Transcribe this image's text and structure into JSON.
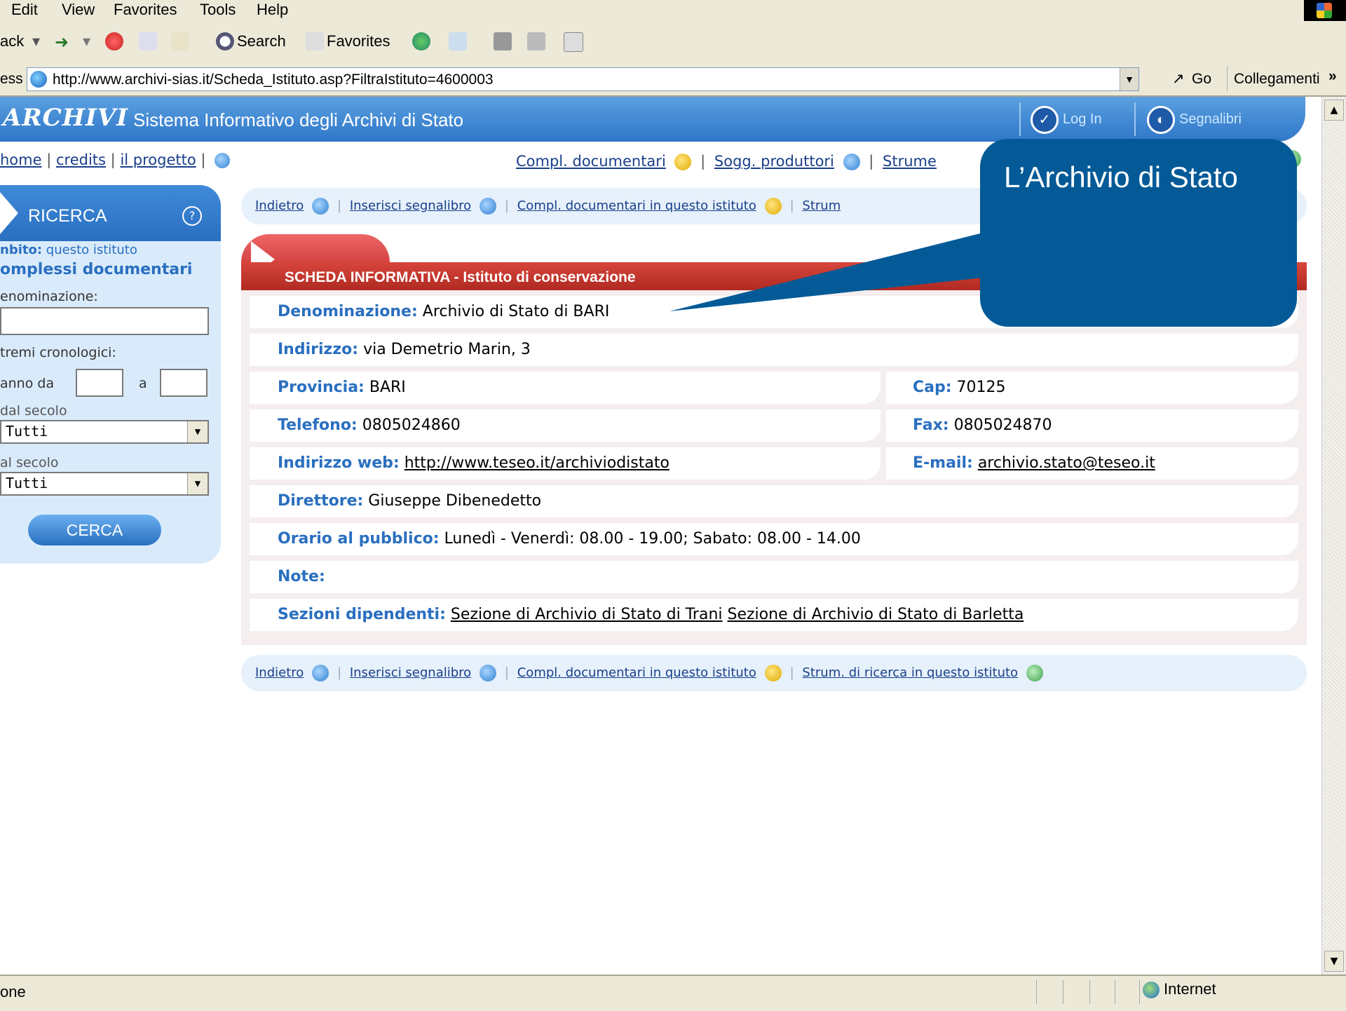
{
  "menu": [
    "Edit",
    "View",
    "Favorites",
    "Tools",
    "Help"
  ],
  "toolbar": {
    "back": "ack",
    "search": "Search",
    "favorites": "Favorites"
  },
  "address": {
    "label": "ess",
    "url": "http://www.archivi-sias.it/Scheda_Istituto.asp?FiltraIstituto=4600003",
    "go": "Go",
    "links": "Collegamenti",
    "more": "»"
  },
  "header": {
    "brand": "ARCHIVI",
    "subtitle": "Sistema Informativo degli Archivi di Stato",
    "login": "Log In",
    "bookmarks": "Segnalibri"
  },
  "toplinks": {
    "home": "home",
    "credits": "credits",
    "project": "il progetto",
    "compl": "Compl. documentari",
    "sogg": "Sogg. produttori",
    "strum": "Strume"
  },
  "left": {
    "title": "RICERCA",
    "ambito_label": "nbito:",
    "ambito_value": "questo istituto",
    "section": "omplessi documentari",
    "denominazione": "enominazione:",
    "estremi": "tremi cronologici:",
    "anno_da": "anno da",
    "a": "a",
    "dal_secolo": "dal secolo",
    "dal_value": "Tutti",
    "al_secolo": "al secolo",
    "al_value": "Tutti",
    "cerca": "CERCA"
  },
  "nav": {
    "back": "Indietro",
    "bookmark": "Inserisci segnalibro",
    "compl": "Compl. documentari in questo istituto",
    "strum_short": "Strum",
    "strum_full": "Strum. di ricerca in questo istituto"
  },
  "scheda": {
    "title": "SCHEDA INFORMATIVA  -  Istituto di conservazione",
    "denominazione_label": "Denominazione:",
    "denominazione": "Archivio di Stato di BARI",
    "indirizzo_label": "Indirizzo:",
    "indirizzo": "via Demetrio Marin, 3",
    "provincia_label": "Provincia:",
    "provincia": "BARI",
    "cap_label": "Cap:",
    "cap": "70125",
    "telefono_label": "Telefono:",
    "telefono": "0805024860",
    "fax_label": "Fax:",
    "fax": "0805024870",
    "web_label": "Indirizzo web:",
    "web": "http://www.teseo.it/archiviodistato",
    "email_label": "E-mail:",
    "email": "archivio.stato@teseo.it",
    "direttore_label": "Direttore:",
    "direttore": "Giuseppe Dibenedetto",
    "orario_label": "Orario al pubblico:",
    "orario": "Lunedì - Venerdì: 08.00 - 19.00; Sabato: 08.00 - 14.00",
    "note_label": "Note:",
    "sezioni_label": "Sezioni dipendenti:",
    "sezione1": "Sezione di Archivio di Stato di Trani",
    "sezione2": "Sezione di Archivio di Stato di Barletta"
  },
  "callout": {
    "text": "L’Archivio di Stato"
  },
  "status": {
    "done": "one",
    "zone": "Internet"
  },
  "colors": {
    "header_blue": "#2f76c8",
    "scheda_red": "#c0342c",
    "callout": "#035a97",
    "label_blue": "#2a6fc0"
  }
}
